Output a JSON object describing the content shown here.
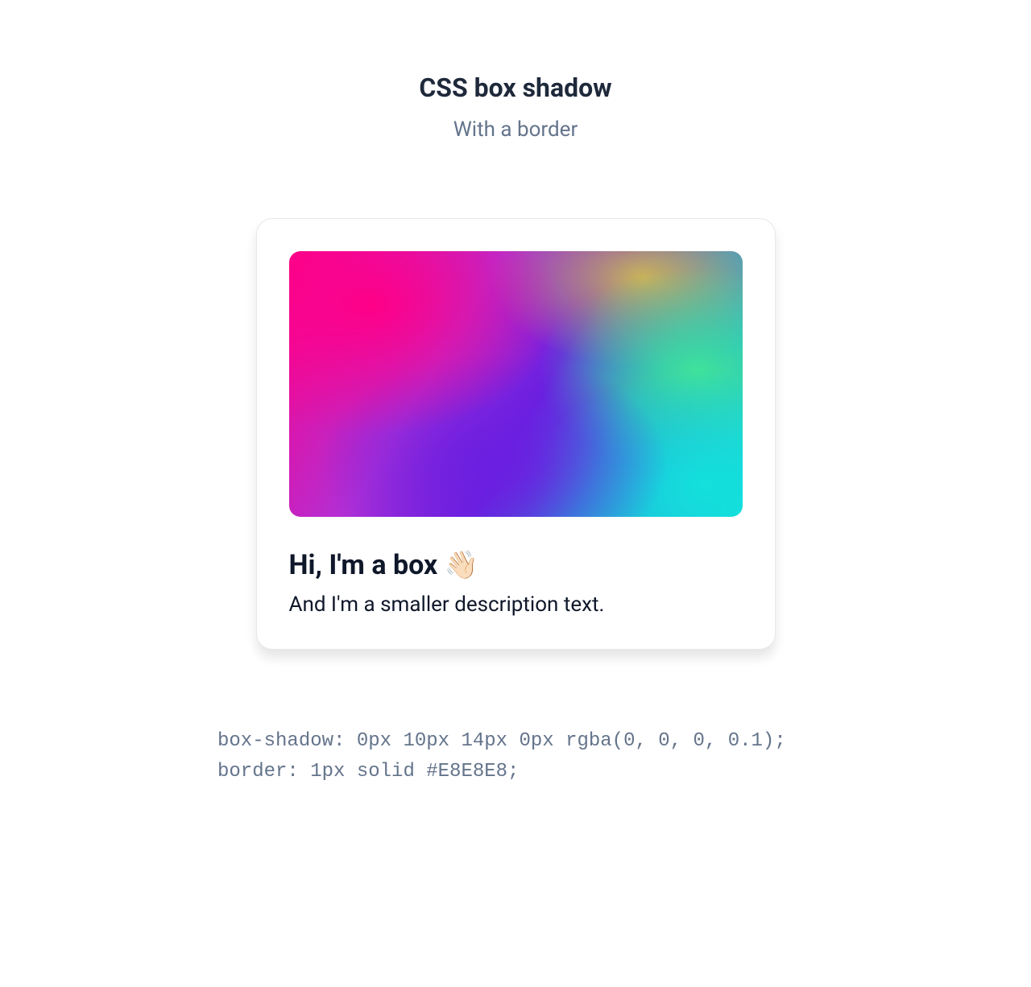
{
  "header": {
    "title": "CSS box shadow",
    "subtitle": "With a border"
  },
  "card": {
    "title": "Hi, I'm a box 👋🏻",
    "description": "And I'm a smaller description text."
  },
  "code": {
    "line1": "box-shadow: 0px 10px 14px 0px rgba(0, 0, 0, 0.1);",
    "line2": "border: 1px solid #E8E8E8;"
  }
}
